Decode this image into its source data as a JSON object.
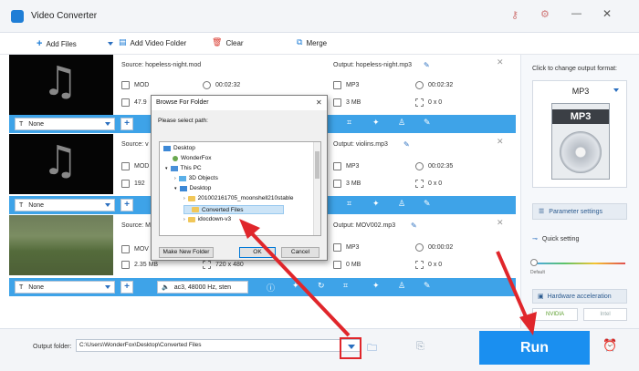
{
  "app": {
    "title": "Video Converter"
  },
  "toolbar": {
    "add_files": "Add Files",
    "add_video_folder": "Add Video Folder",
    "clear": "Clear",
    "merge": "Merge"
  },
  "rows": [
    {
      "source": "Source: hopeless-night.mod",
      "src_format": "MOD",
      "src_duration": "00:02:32",
      "src_size": "47.9",
      "output": "Output: hopeless-night.mp3",
      "out_format": "MP3",
      "out_duration": "00:02:32",
      "out_size": "3 MB",
      "out_res": "0 x 0",
      "subtitle": "None"
    },
    {
      "source": "Source: v",
      "src_format": "MOD",
      "src_size": "192",
      "output": "Output: violins.mp3",
      "out_format": "MP3",
      "out_duration": "00:02:35",
      "out_size": "3 MB",
      "out_res": "0 x 0",
      "subtitle": "None"
    },
    {
      "source": "Source: M",
      "src_format": "MOV",
      "src_size": "2.35 MB",
      "src_res": "720 x 480",
      "output": "Output: MOV002.mp3",
      "out_format": "MP3",
      "out_duration": "00:00:02",
      "out_size": "0 MB",
      "out_res": "0 x 0",
      "subtitle": "None",
      "audio": "ac3, 48000 Hz, sten"
    }
  ],
  "sidebar": {
    "hint": "Click to change output format:",
    "format": "MP3",
    "format_badge": "MP3",
    "parameter_settings": "Parameter settings",
    "quick_setting": "Quick setting",
    "default": "Default",
    "hw_accel": "Hardware acceleration",
    "nvidia": "NVIDIA",
    "intel": "Intel"
  },
  "dialog": {
    "title": "Browse For Folder",
    "prompt": "Please select path:",
    "tree": [
      "Desktop",
      "WonderFox",
      "This PC",
      "3D Objects",
      "Desktop",
      "201002161705_moonshell210stable",
      "Converted Files",
      "idocdown-v3"
    ],
    "make_new_folder": "Make New Folder",
    "ok": "OK",
    "cancel": "Cancel"
  },
  "bottom": {
    "output_label": "Output folder:",
    "output_path": "C:\\Users\\WonderFox\\Desktop\\Converted Files",
    "run": "Run"
  },
  "colors": {
    "accent": "#1a8ff0",
    "bar": "#3ea3e8",
    "annotation": "#e0262b"
  }
}
